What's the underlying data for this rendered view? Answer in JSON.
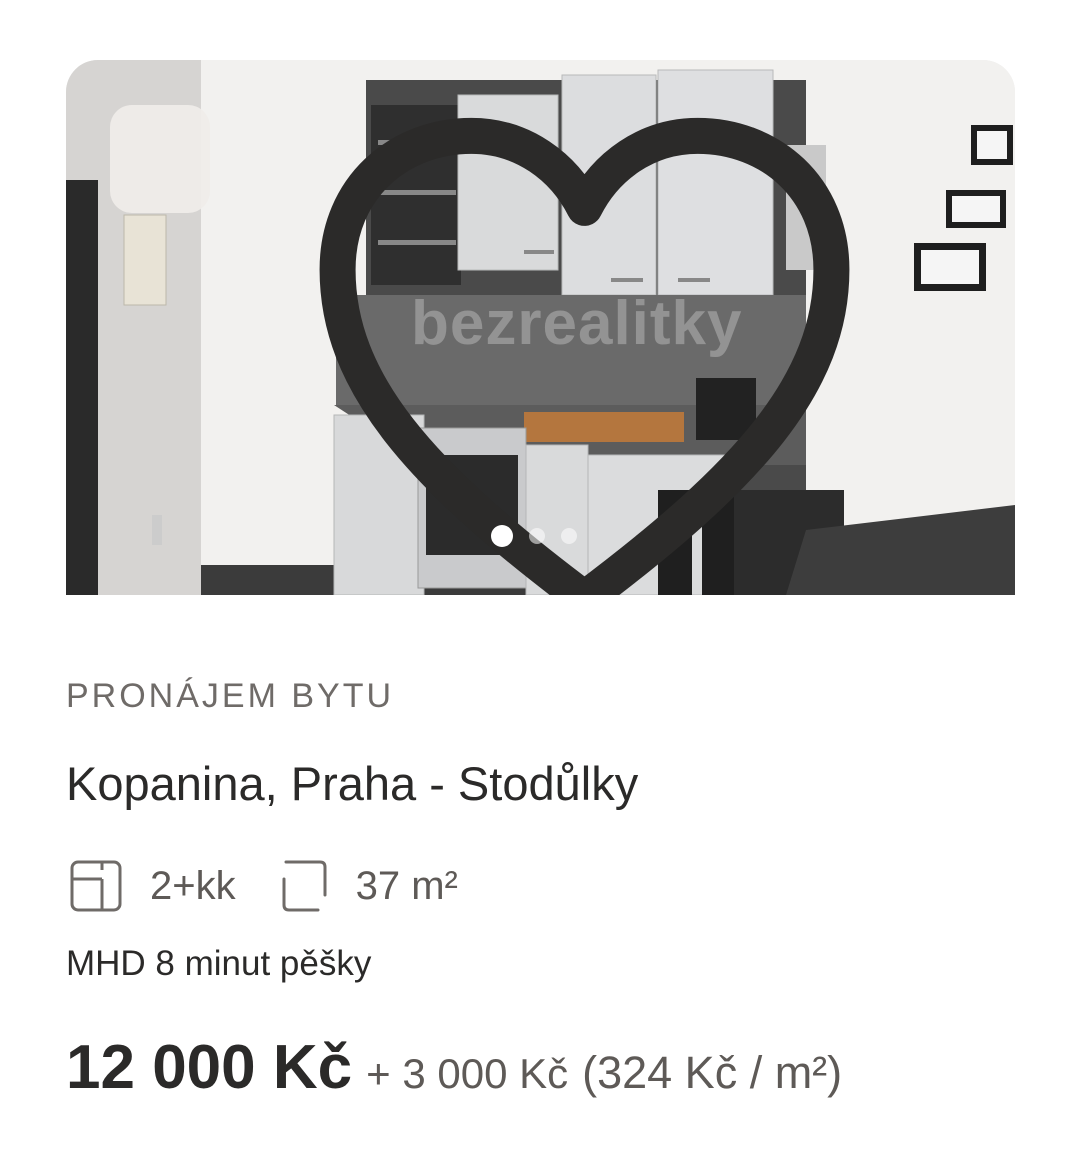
{
  "listing": {
    "favorite_icon": "heart-outline-icon",
    "watermark": "bezrealitky",
    "gallery": {
      "count": 3,
      "active_index": 0
    },
    "category": "PRONÁJEM BYTU",
    "title": "Kopanina, Praha - Stodůlky",
    "layout": "2+kk",
    "layout_icon": "floorplan-icon",
    "area": "37 m²",
    "area_icon": "area-square-icon",
    "transit": "MHD 8 minut pěšky",
    "price": "12 000 Kč",
    "price_extra": "+ 3 000 Kč",
    "price_per_m2": "(324 Kč / m²)"
  },
  "colors": {
    "text": "#2b2a29",
    "muted": "#6f6b68",
    "background": "#ffffff"
  }
}
